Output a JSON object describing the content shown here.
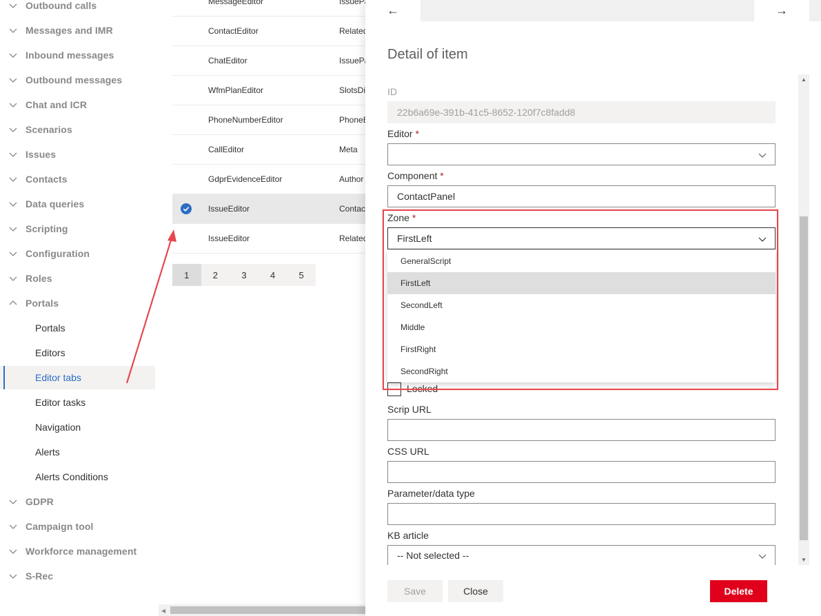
{
  "sidebar": {
    "groups_top": [
      {
        "label": "Outbound calls"
      },
      {
        "label": "Messages and IMR"
      },
      {
        "label": "Inbound messages"
      },
      {
        "label": "Outbound messages"
      },
      {
        "label": "Chat and ICR"
      },
      {
        "label": "Scenarios"
      },
      {
        "label": "Issues"
      },
      {
        "label": "Contacts"
      },
      {
        "label": "Data queries"
      },
      {
        "label": "Scripting"
      },
      {
        "label": "Configuration"
      },
      {
        "label": "Roles"
      },
      {
        "label": "Portals"
      }
    ],
    "portals_items": [
      {
        "label": "Portals"
      },
      {
        "label": "Editors"
      },
      {
        "label": "Editor tabs"
      },
      {
        "label": "Editor tasks"
      },
      {
        "label": "Navigation"
      },
      {
        "label": "Alerts"
      },
      {
        "label": "Alerts Conditions"
      }
    ],
    "groups_bottom": [
      {
        "label": "GDPR"
      },
      {
        "label": "Campaign tool"
      },
      {
        "label": "Workforce management"
      },
      {
        "label": "S-Rec"
      }
    ]
  },
  "list": {
    "rows": [
      {
        "editor": "MessageEditor",
        "component": "IssuePa"
      },
      {
        "editor": "ContactEditor",
        "component": "Related"
      },
      {
        "editor": "ChatEditor",
        "component": "IssuePa"
      },
      {
        "editor": "WfmPlanEditor",
        "component": "SlotsDi"
      },
      {
        "editor": "PhoneNumberEditor",
        "component": "PhoneE"
      },
      {
        "editor": "CallEditor",
        "component": "Meta"
      },
      {
        "editor": "GdprEvidenceEditor",
        "component": "Author"
      },
      {
        "editor": "IssueEditor",
        "component": "Contac"
      },
      {
        "editor": "IssueEditor",
        "component": "Related"
      }
    ],
    "pages": [
      "1",
      "2",
      "3",
      "4",
      "5"
    ]
  },
  "panel": {
    "back_arrow": "←",
    "forward_arrow": "→",
    "title": "Detail of item",
    "id_label": "ID",
    "id_value": "22b6a69e-391b-41c5-8652-120f7c8fadd8",
    "editor_label": "Editor",
    "editor_value": "",
    "component_label": "Component",
    "component_value": "ContactPanel",
    "zone_label": "Zone",
    "zone_value": "FirstLeft",
    "zone_options": [
      "GeneralScript",
      "FirstLeft",
      "SecondLeft",
      "Middle",
      "FirstRight",
      "SecondRight"
    ],
    "locked_label": "Locked",
    "script_url_label": "Scrip URL",
    "script_url_value": "",
    "css_url_label": "CSS URL",
    "css_url_value": "",
    "param_label": "Parameter/data type",
    "param_value": "",
    "kb_label": "KB article",
    "kb_value": "-- Not selected --",
    "required_mark": "*",
    "save_label": "Save",
    "close_label": "Close",
    "delete_label": "Delete"
  },
  "colors": {
    "accent": "#2b6cc4",
    "delete": "#e0001b",
    "highlight": "#e5484d",
    "required": "#a4262c"
  }
}
